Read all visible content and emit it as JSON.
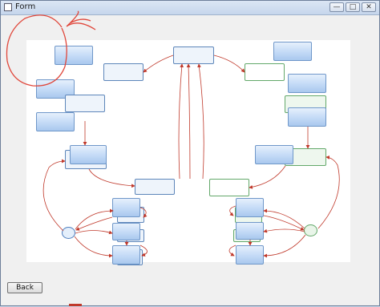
{
  "window": {
    "title": "Form",
    "minimize_glyph": "—",
    "maximize_glyph": "□",
    "close_glyph": "✕"
  },
  "icons": {
    "app": "form-window-icon"
  },
  "footer": {
    "back_label": "Back"
  },
  "colors": {
    "arrow": "#c0392b",
    "node_blue": "#a9c8ee",
    "node_border": "#6f97c9",
    "green_border": "#63a86a",
    "annotation": "#e0463a"
  }
}
